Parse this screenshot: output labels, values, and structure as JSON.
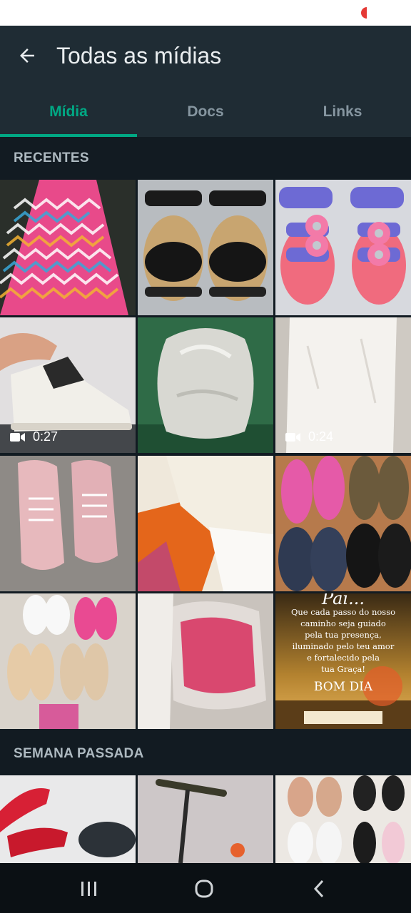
{
  "header": {
    "title": "Todas as mídias",
    "back_icon": "arrow-left-icon"
  },
  "tabs": [
    {
      "label": "Mídia",
      "active": true
    },
    {
      "label": "Docs",
      "active": false
    },
    {
      "label": "Links",
      "active": false
    }
  ],
  "sections": [
    {
      "label": "RECENTES"
    },
    {
      "label": "SEMANA PASSADA"
    }
  ],
  "media": {
    "video_1_duration": "0:27",
    "video_2_duration": "0:24",
    "greeting_image": {
      "line1": "Pai...",
      "line2": "Que cada passo do nosso",
      "line3": "caminho seja guiado",
      "line4": "pela tua presença,",
      "line5": "iluminado pelo teu amor",
      "line6": "e fortalecido pela",
      "line7": "tua Graça!",
      "greeting": "BOM DIA"
    }
  },
  "colors": {
    "accent": "#00a884",
    "appbar": "#1f2c34",
    "background": "#121b22"
  },
  "navbar": {
    "icons": [
      "recent-apps-icon",
      "home-icon",
      "back-nav-icon"
    ]
  }
}
